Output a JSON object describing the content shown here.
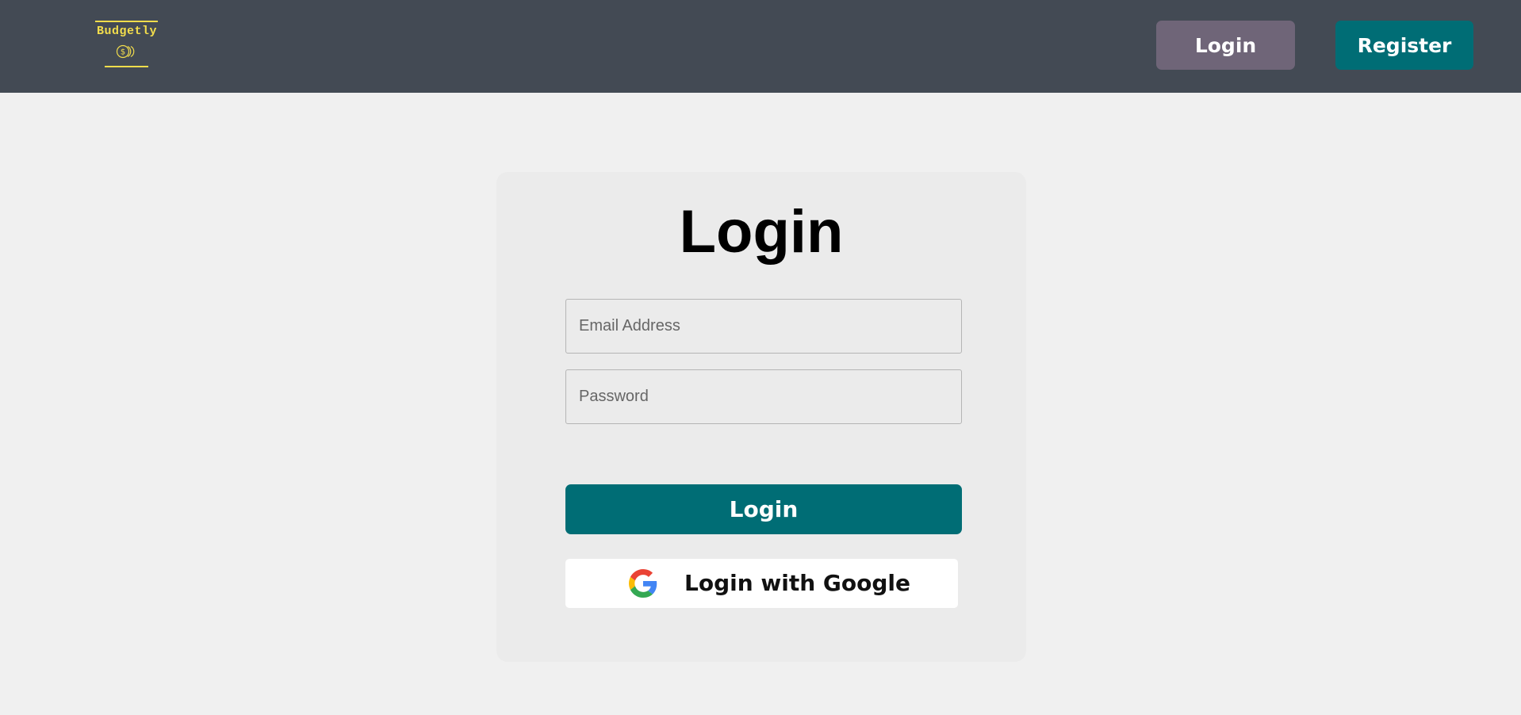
{
  "app": {
    "brand": "Budgetly",
    "logo_icon": "coins-icon"
  },
  "navbar": {
    "login_label": "Login",
    "register_label": "Register"
  },
  "login_form": {
    "title": "Login",
    "email_placeholder": "Email Address",
    "password_placeholder": "Password",
    "submit_label": "Login",
    "google_label": "Login with Google",
    "google_icon": "google-icon"
  },
  "colors": {
    "navbar_bg": "#434a54",
    "brand_yellow": "#f2dd4c",
    "nav_login_bg": "#6f6578",
    "accent_teal": "#006d75",
    "page_bg": "#f0f0f0",
    "card_bg": "#ebebeb"
  }
}
